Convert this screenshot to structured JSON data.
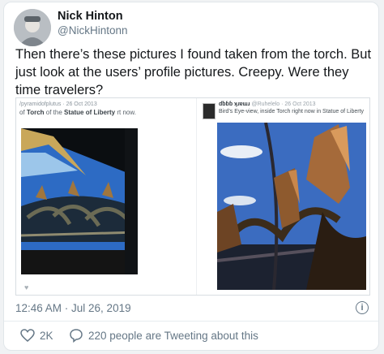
{
  "author": {
    "name": "Nick Hinton",
    "handle": "@NickHintonn"
  },
  "tweet": {
    "text": "Then there’s these pictures I found taken from the torch. But just look at the users’ profile pictures. Creepy. Were they time travelers?"
  },
  "embedded": {
    "left": {
      "meta": "/pyramidofplutus · 26 Oct 2013",
      "caption_prefix": "of ",
      "caption_bold_1": "Torch",
      "caption_mid": " of the ",
      "caption_bold_2": "Statue of Liberty",
      "caption_suffix": " rt now. "
    },
    "right": {
      "user": "ɗɓɓɓ ʞɹɐɯɹ",
      "meta": " @Ruhelelo · 26 Oct 2013",
      "caption": "Bird's Eye-view, inside Torch right now in Statue of Liberty"
    }
  },
  "timestamp": "12:46 AM · Jul 26, 2019",
  "info_glyph": "i",
  "actions": {
    "like_count": "2K",
    "replies_text": "220 people are Tweeting about this"
  },
  "colors": {
    "text": "#14171a",
    "secondary": "#657786",
    "sky": "#2e5ea8"
  }
}
